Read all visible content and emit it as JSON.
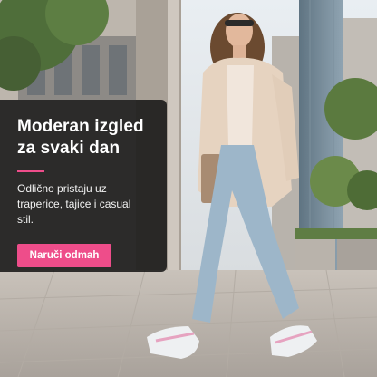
{
  "promo": {
    "title_line1": "Moderan izgled",
    "title_line2": "za svaki dan",
    "description": "Odlično pristaju uz traperice, tajice i casual stil.",
    "cta_label": "Naruči odmah"
  },
  "colors": {
    "accent": "#ee4d8a",
    "card_background": "#141414",
    "text": "#ffffff"
  }
}
